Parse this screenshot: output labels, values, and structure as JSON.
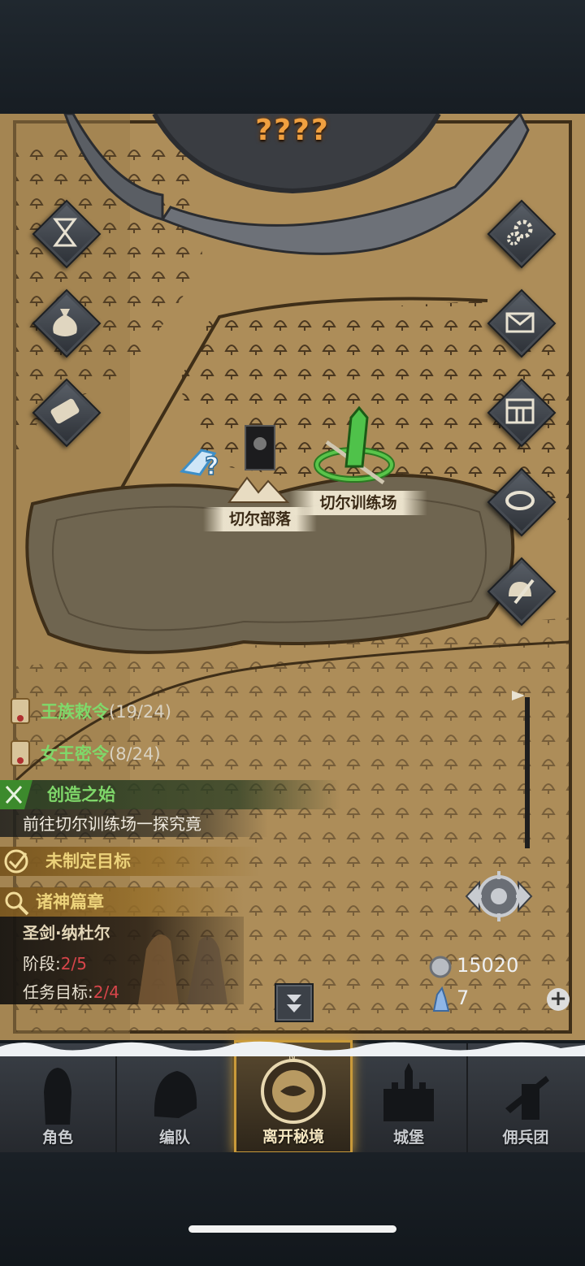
{
  "map": {
    "title": "????",
    "locations": [
      {
        "name": "切尔部落"
      },
      {
        "name": "切尔训练场"
      }
    ]
  },
  "left_buttons": [
    {
      "icon": "hourglass-icon"
    },
    {
      "icon": "money-bag-icon"
    },
    {
      "icon": "scroll-icon"
    }
  ],
  "right_buttons": [
    {
      "icon": "gear-icon"
    },
    {
      "icon": "mail-icon"
    },
    {
      "icon": "gate-icon"
    },
    {
      "icon": "drum-icon"
    },
    {
      "icon": "helmet-sword-icon"
    }
  ],
  "quests": {
    "royal_edict": {
      "title": "王族敕令",
      "count": "(19/24)"
    },
    "queen_order": {
      "title": "女王密令",
      "count": "(8/24)"
    },
    "main": {
      "title": "创造之始",
      "desc": "前往切尔训练场一探究竟"
    },
    "goal": {
      "title": "未制定目标"
    },
    "gods": {
      "title": "诸神篇章",
      "hero": "圣剑·纳杜尔",
      "stage_label": "阶段:",
      "stage_value": "2/5",
      "task_label": "任务目标:",
      "task_value": "2/4"
    }
  },
  "currency": {
    "silver": "15020",
    "crystal": "7"
  },
  "nav": [
    {
      "label": "角色",
      "icon": "knight-icon"
    },
    {
      "label": "编队",
      "icon": "helmet-icon"
    },
    {
      "label": "离开秘境",
      "icon": "compass-map-icon",
      "active": true
    },
    {
      "label": "城堡",
      "icon": "castle-icon"
    },
    {
      "label": "佣兵团",
      "icon": "mercenary-icon"
    }
  ],
  "colors": {
    "accent": "#c99a3a",
    "quest_green": "#7fd86a",
    "progress_red": "#d8454a",
    "map_parchment": "#b0915e"
  }
}
